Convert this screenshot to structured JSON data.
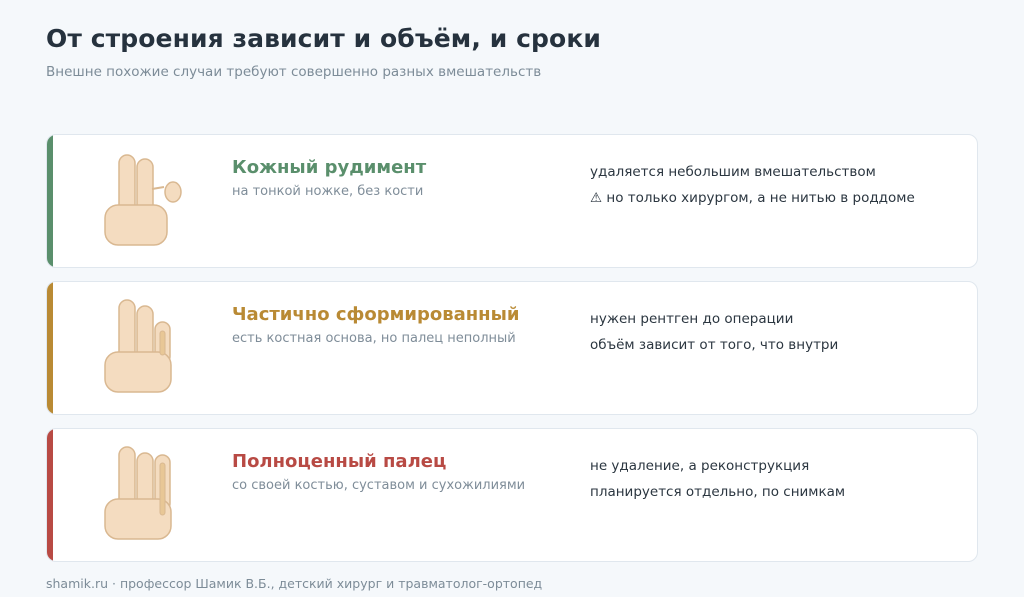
{
  "header": {
    "title": "От строения зависит и объём, и сроки",
    "subtitle": "Внешне похожие случаи требуют совершенно разных вмешательств"
  },
  "cards": [
    {
      "name": "Кожный рудимент",
      "desc": "на тонкой ножке, без кости",
      "note1": "удаляется небольшим вмешательством",
      "note2": "⚠ но только хирургом, а не нитью в роддоме",
      "color": "#5a8f6c",
      "icon": "hand-skin-tag-icon"
    },
    {
      "name": "Частично сформированный",
      "desc": "есть костная основа, но палец неполный",
      "note1": "нужен рентген до операции",
      "note2": "объём зависит от того, что внутри",
      "color": "#b98a34",
      "icon": "hand-partial-finger-icon"
    },
    {
      "name": "Полноценный палец",
      "desc": "со своей костью, суставом и сухожилиями",
      "note1": "не удаление, а реконструкция",
      "note2": "планируется отдельно, по снимкам",
      "color": "#b84a44",
      "icon": "hand-full-finger-icon"
    }
  ],
  "colors": {
    "skin_fill": "#f4dcc0",
    "skin_stroke": "#d9b891",
    "bone_fill": "#e8c796"
  },
  "footer": "shamik.ru · профессор Шамик В.Б., детский хирург и травматолог-ортопед"
}
